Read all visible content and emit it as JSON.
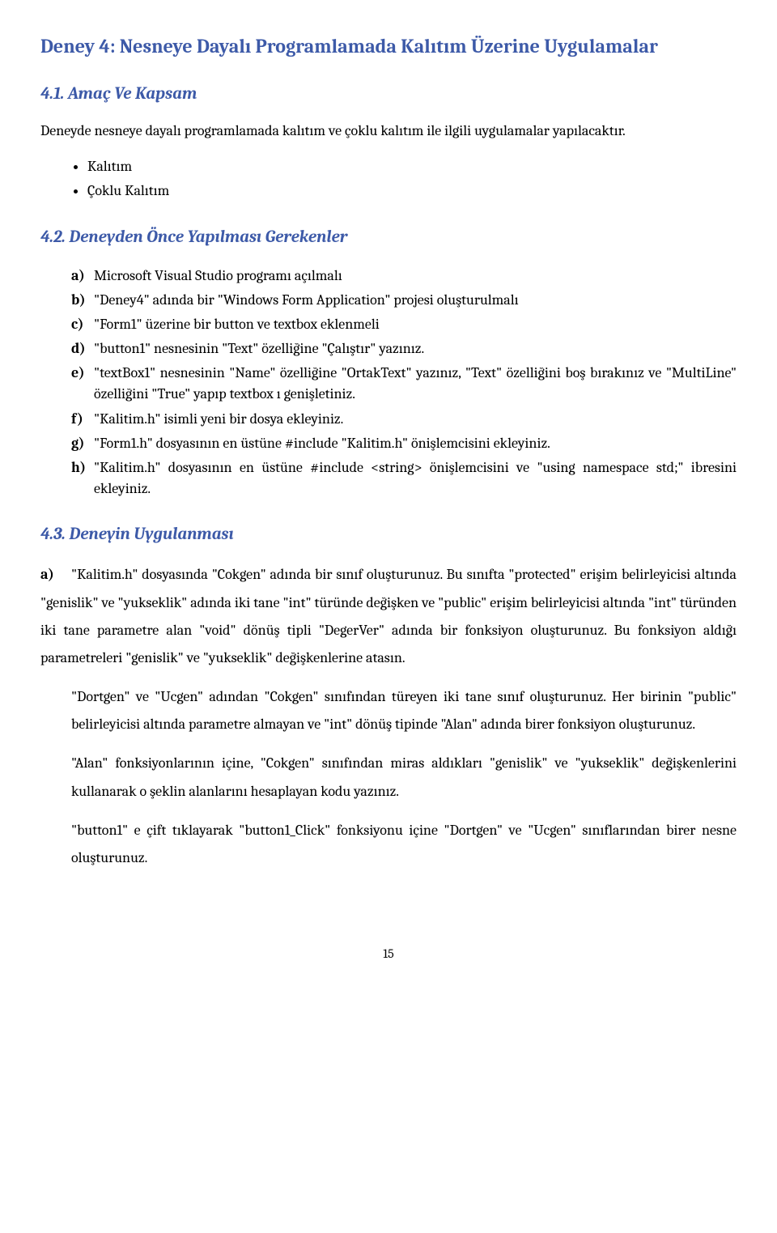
{
  "titleMain": "Deney 4: Nesneye Dayalı Programlamada Kalıtım Üzerine Uygulamalar",
  "sec41": {
    "head": "4.1. Amaç Ve Kapsam",
    "intro": "Deneyde nesneye dayalı programlamada kalıtım ve çoklu kalıtım ile ilgili uygulamalar yapılacaktır.",
    "topics": [
      "Kalıtım",
      "Çoklu Kalıtım"
    ]
  },
  "sec42": {
    "head": "4.2. Deneyden Önce Yapılması Gerekenler",
    "items": [
      {
        "m": "a)",
        "t": "Microsoft Visual Studio programı açılmalı"
      },
      {
        "m": "b)",
        "t": "\"Deney4\" adında bir \"Windows Form Application\" projesi oluşturulmalı"
      },
      {
        "m": "c)",
        "t": "\"Form1\" üzerine bir button ve textbox eklenmeli"
      },
      {
        "m": "d)",
        "t": "\"button1\" nesnesinin \"Text\" özelliğine \"Çalıştır\" yazınız."
      },
      {
        "m": "e)",
        "t": "\"textBox1\" nesnesinin \"Name\" özelliğine \"OrtakText\" yazınız, \"Text\" özelliğini boş bırakınız ve \"MultiLine\" özelliğini \"True\" yapıp textbox ı genişletiniz."
      },
      {
        "m": "f)",
        "t": "\"Kalitim.h\" isimli yeni bir dosya ekleyiniz."
      },
      {
        "m": "g)",
        "t": "\"Form1.h\" dosyasının en üstüne #include \"Kalitim.h\" önişlemcisini ekleyiniz."
      },
      {
        "m": "h)",
        "t": "\"Kalitim.h\" dosyasının en üstüne #include <string> önişlemcisini ve \"using namespace std;\" ibresini ekleyiniz."
      }
    ]
  },
  "sec43": {
    "head": "4.3. Deneyin Uygulanması",
    "leadMarker": "a)",
    "p1": "\"Kalitim.h\" dosyasında \"Cokgen\" adında bir sınıf oluşturunuz. Bu sınıfta \"protected\" erişim belirleyicisi altında \"genislik\" ve \"yukseklik\" adında iki tane \"int\" türünde değişken ve \"public\" erişim belirleyicisi altında \"int\" türünden iki tane parametre alan \"void\" dönüş tipli \"DegerVer\" adında bir fonksiyon oluşturunuz. Bu fonksiyon aldığı parametreleri \"genislik\" ve \"yukseklik\" değişkenlerine atasın.",
    "p2": "\"Dortgen\" ve \"Ucgen\" adından \"Cokgen\" sınıfından türeyen iki tane sınıf oluşturunuz. Her birinin \"public\" belirleyicisi altında parametre almayan ve \"int\" dönüş tipinde \"Alan\" adında birer fonksiyon oluşturunuz.",
    "p3": "\"Alan\" fonksiyonlarının içine, \"Cokgen\" sınıfından miras aldıkları \"genislik\" ve \"yukseklik\" değişkenlerini kullanarak o şeklin alanlarını hesaplayan kodu yazınız.",
    "p4": "\"button1\" e çift tıklayarak \"button1_Click\" fonksiyonu içine \"Dortgen\" ve \"Ucgen\" sınıflarından birer nesne oluşturunuz."
  },
  "pageNumber": "15"
}
